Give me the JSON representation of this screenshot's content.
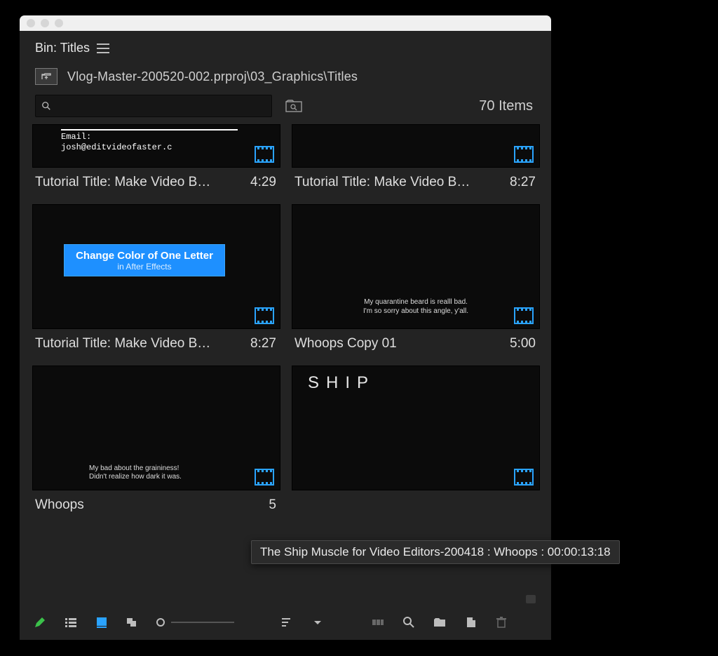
{
  "panel": {
    "tab_label": "Bin: Titles",
    "breadcrumb": "Vlog-Master-200520-002.prproj\\03_Graphics\\Titles",
    "item_count_label": "70 Items"
  },
  "search": {
    "value": "",
    "placeholder": ""
  },
  "items": [
    {
      "name": "Tutorial Title: Make Video B…",
      "duration": "4:29",
      "thumb_text_top": "Email:",
      "thumb_text_bottom": "josh@editvideofaster.c"
    },
    {
      "name": "Tutorial Title: Make Video B…",
      "duration": "8:27"
    },
    {
      "name": "Tutorial Title: Make Video B…",
      "duration": "8:27",
      "thumb_main": "Change Color of One Letter",
      "thumb_sub": "in After Effects"
    },
    {
      "name": "Whoops Copy 01",
      "duration": "5:00",
      "thumb_line1": "My quarantine beard is realll bad.",
      "thumb_line2": "I'm so sorry about this angle, y'all."
    },
    {
      "name": "Whoops",
      "duration": "5",
      "thumb_line1": "My bad about the graininess!",
      "thumb_line2": "Didn't realize how dark it was."
    },
    {
      "name": "",
      "duration": "",
      "thumb_ship": "SHIP"
    }
  ],
  "tooltip": "The Ship Muscle for Video Editors-200418 : Whoops : 00:00:13:18"
}
